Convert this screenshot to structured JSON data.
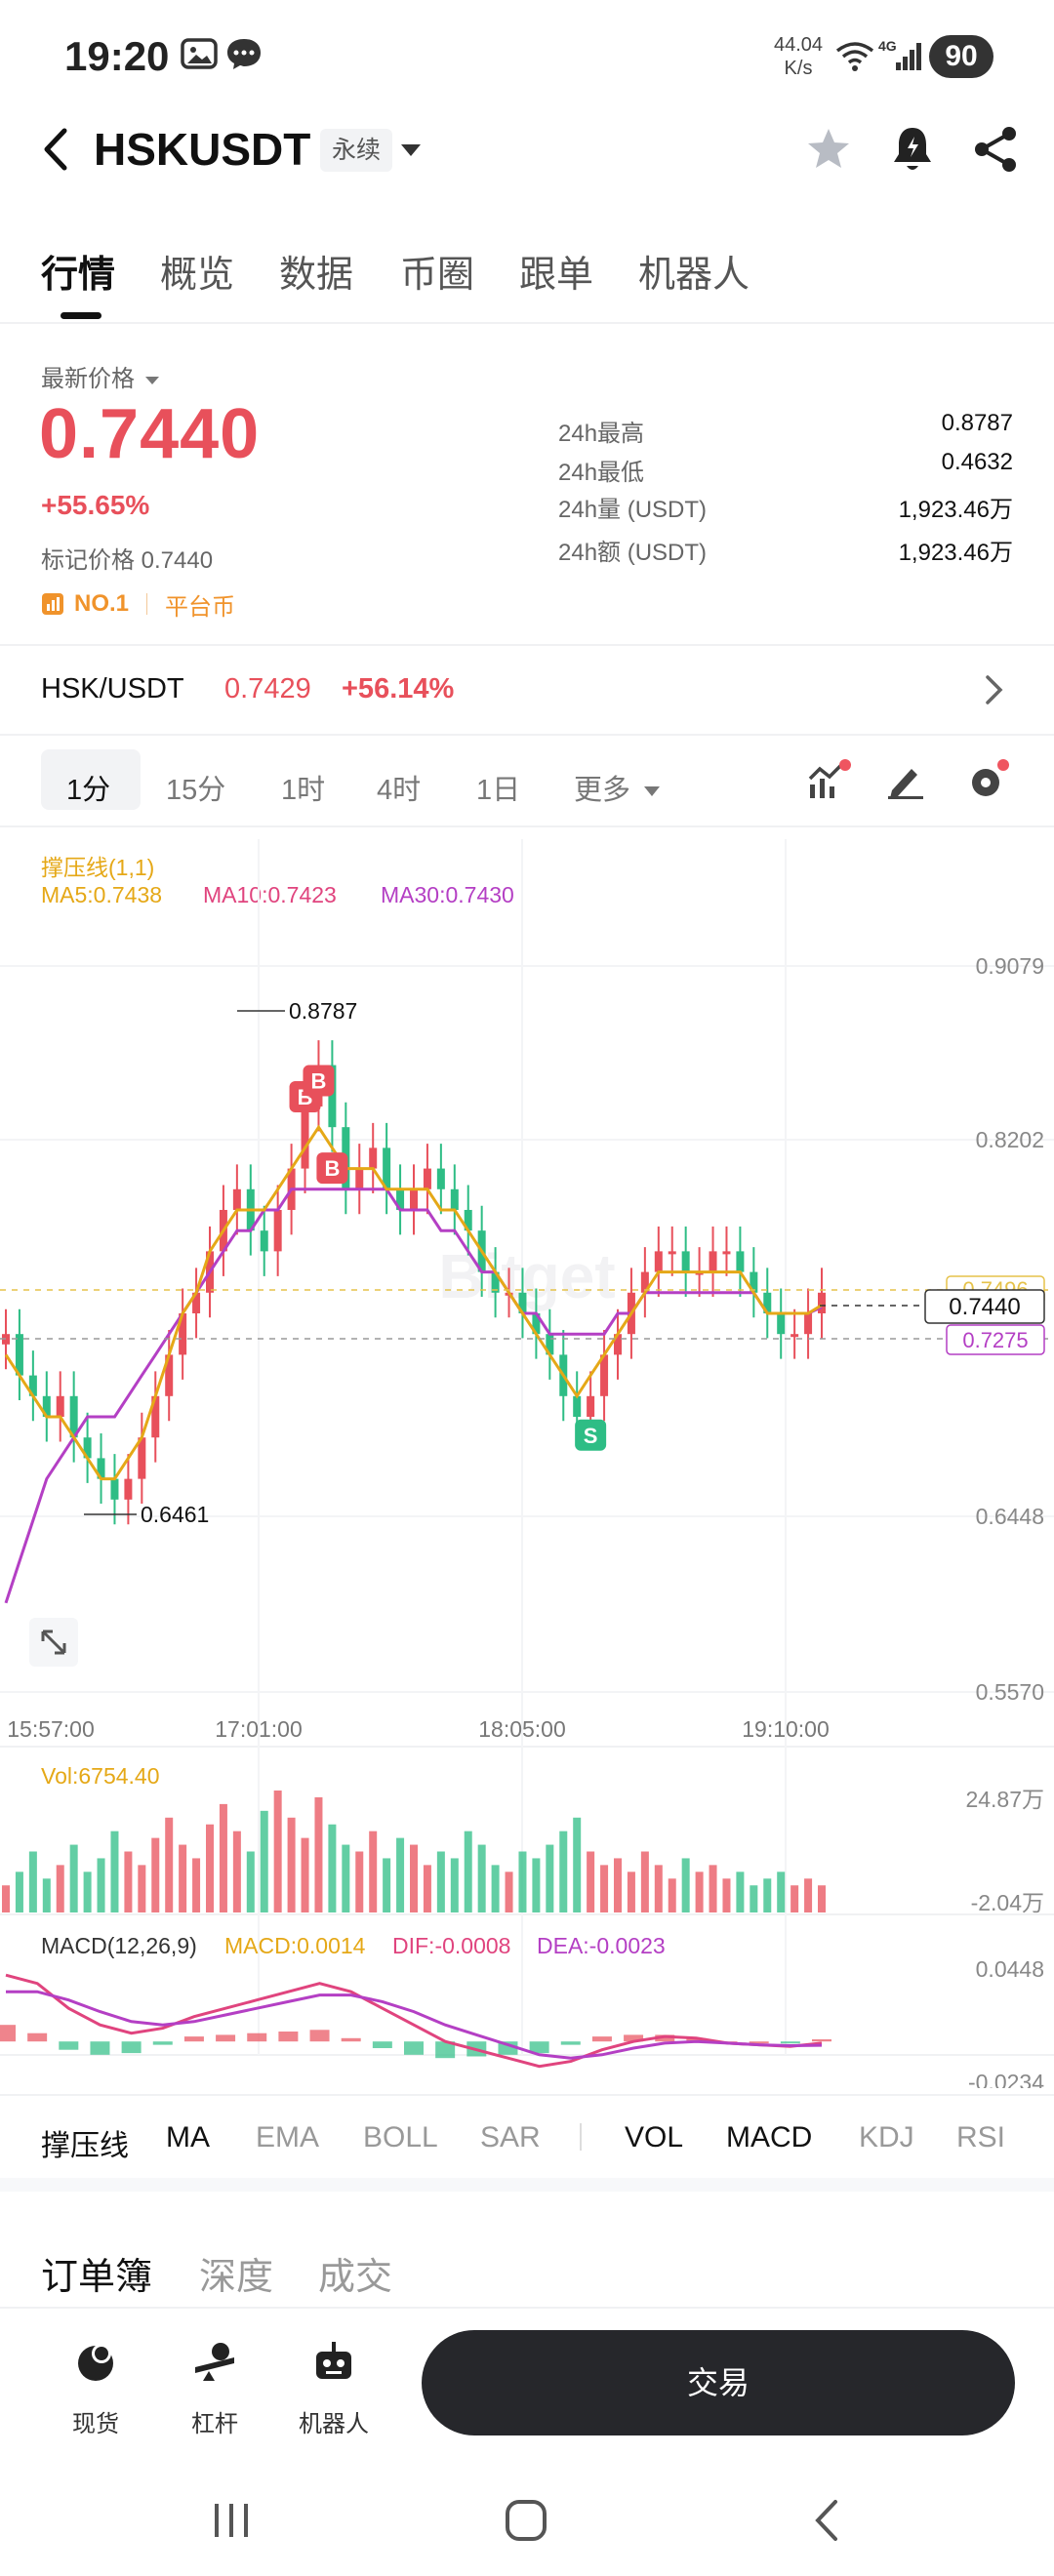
{
  "status_bar": {
    "time": "19:20",
    "net_speed_value": "44.04",
    "net_speed_unit": "K/s",
    "battery": "90"
  },
  "header": {
    "pair": "HSKUSDT",
    "badge": "永续"
  },
  "main_tabs": [
    "行情",
    "概览",
    "数据",
    "币圈",
    "跟单",
    "机器人"
  ],
  "price_block": {
    "latest_label": "最新价格",
    "last_price": "0.7440",
    "change": "+55.65%",
    "mark_price": "标记价格 0.7440",
    "rank": "NO.1",
    "category": "平台币",
    "stats": [
      {
        "label": "24h最高",
        "value": "0.8787"
      },
      {
        "label": "24h最低",
        "value": "0.4632"
      },
      {
        "label": "24h量 (USDT)",
        "value": "1,923.46万"
      },
      {
        "label": "24h额 (USDT)",
        "value": "1,923.46万"
      }
    ]
  },
  "spot_row": {
    "pair": "HSK/USDT",
    "price": "0.7429",
    "change": "+56.14%"
  },
  "interval_tabs": [
    "1分",
    "15分",
    "1时",
    "4时",
    "1日",
    "更多"
  ],
  "chart_data": {
    "type": "candlestick",
    "legend": {
      "support_line": "撑压线(1,1)",
      "ma5": "MA5:0.7438",
      "ma10": "MA10:0.7423",
      "ma30": "MA30:0.7430"
    },
    "y_axis_labels": [
      "0.9079",
      "0.8202",
      "0.6448",
      "0.5570"
    ],
    "ylim": [
      0.557,
      0.9079
    ],
    "x_axis_labels": [
      "15:57:00",
      "17:01:00",
      "18:05:00",
      "19:10:00"
    ],
    "high_marker": "0.8787",
    "low_marker": "0.6461",
    "price_tag_current": "0.7440",
    "price_tag_upper": "0.7496",
    "price_tag_lower": "0.7275",
    "close_series": [
      0.73,
      0.71,
      0.7,
      0.69,
      0.7,
      0.68,
      0.67,
      0.66,
      0.65,
      0.66,
      0.68,
      0.7,
      0.72,
      0.74,
      0.75,
      0.77,
      0.79,
      0.8,
      0.78,
      0.77,
      0.79,
      0.81,
      0.84,
      0.86,
      0.83,
      0.8,
      0.81,
      0.82,
      0.8,
      0.79,
      0.8,
      0.81,
      0.8,
      0.79,
      0.78,
      0.76,
      0.75,
      0.75,
      0.74,
      0.73,
      0.72,
      0.7,
      0.69,
      0.7,
      0.72,
      0.73,
      0.75,
      0.76,
      0.77,
      0.77,
      0.76,
      0.76,
      0.77,
      0.77,
      0.76,
      0.75,
      0.74,
      0.73,
      0.73,
      0.74,
      0.75
    ],
    "ma5_series": [
      0.72,
      0.71,
      0.7,
      0.69,
      0.69,
      0.68,
      0.67,
      0.66,
      0.66,
      0.67,
      0.68,
      0.7,
      0.72,
      0.74,
      0.75,
      0.77,
      0.78,
      0.79,
      0.79,
      0.79,
      0.8,
      0.81,
      0.82,
      0.83,
      0.82,
      0.81,
      0.81,
      0.81,
      0.8,
      0.8,
      0.8,
      0.8,
      0.79,
      0.79,
      0.78,
      0.77,
      0.76,
      0.75,
      0.74,
      0.73,
      0.72,
      0.71,
      0.7,
      0.71,
      0.72,
      0.73,
      0.74,
      0.75,
      0.76,
      0.76,
      0.76,
      0.76,
      0.76,
      0.76,
      0.76,
      0.75,
      0.74,
      0.74,
      0.74,
      0.74,
      0.744
    ],
    "ma30_series": [
      0.6,
      0.62,
      0.64,
      0.66,
      0.67,
      0.68,
      0.69,
      0.69,
      0.69,
      0.7,
      0.71,
      0.72,
      0.73,
      0.74,
      0.75,
      0.76,
      0.77,
      0.78,
      0.78,
      0.79,
      0.79,
      0.8,
      0.8,
      0.8,
      0.8,
      0.8,
      0.8,
      0.8,
      0.8,
      0.79,
      0.79,
      0.79,
      0.78,
      0.78,
      0.77,
      0.76,
      0.76,
      0.75,
      0.74,
      0.74,
      0.73,
      0.73,
      0.73,
      0.73,
      0.73,
      0.74,
      0.74,
      0.75,
      0.75,
      0.75,
      0.75,
      0.75,
      0.75,
      0.75,
      0.75,
      0.75,
      0.74,
      0.74,
      0.74,
      0.74,
      0.743
    ],
    "trade_markers": [
      {
        "label": "B",
        "index": 22
      },
      {
        "label": "B",
        "index": 23
      },
      {
        "label": "B",
        "index": 24
      },
      {
        "label": "S",
        "index": 43
      }
    ],
    "volume": {
      "label": "Vol:6754.40",
      "axis_top": "24.87万",
      "axis_bottom": "-2.04万",
      "values": [
        4,
        6,
        9,
        5,
        7,
        10,
        6,
        8,
        12,
        9,
        7,
        11,
        14,
        10,
        8,
        13,
        16,
        12,
        9,
        15,
        18,
        14,
        11,
        17,
        13,
        10,
        9,
        12,
        8,
        11,
        10,
        7,
        9,
        8,
        12,
        10,
        7,
        6,
        9,
        8,
        10,
        12,
        14,
        9,
        7,
        8,
        6,
        9,
        7,
        5,
        8,
        6,
        7,
        5,
        6,
        4,
        5,
        6,
        4,
        5,
        4
      ]
    },
    "macd": {
      "label": "MACD(12,26,9)",
      "macd": "MACD:0.0014",
      "dif": "DIF:-0.0008",
      "dea": "DEA:-0.0023",
      "axis_top": "0.0448",
      "axis_bottom": "-0.0234",
      "dif_series": [
        0.04,
        0.035,
        0.02,
        0.01,
        0.005,
        0.008,
        0.015,
        0.02,
        0.025,
        0.03,
        0.035,
        0.03,
        0.02,
        0.01,
        0.0,
        -0.005,
        -0.01,
        -0.015,
        -0.012,
        -0.005,
        0.0,
        0.003,
        0.002,
        -0.001,
        -0.002,
        -0.003,
        -0.001
      ],
      "dea_series": [
        0.03,
        0.03,
        0.025,
        0.018,
        0.012,
        0.01,
        0.012,
        0.016,
        0.02,
        0.024,
        0.028,
        0.028,
        0.024,
        0.018,
        0.01,
        0.004,
        -0.002,
        -0.008,
        -0.01,
        -0.008,
        -0.004,
        -0.001,
        0.0,
        -0.001,
        -0.002,
        -0.0025,
        -0.0023
      ]
    }
  },
  "indicator_tabs": {
    "main": [
      "撑压线",
      "MA",
      "EMA",
      "BOLL",
      "SAR"
    ],
    "sub": [
      "VOL",
      "MACD",
      "KDJ",
      "RSI"
    ]
  },
  "orderbook_tabs": [
    "订单簿",
    "深度",
    "成交"
  ],
  "bottom_bar": {
    "items": [
      "现货",
      "杠杆",
      "机器人"
    ],
    "trade": "交易"
  },
  "colors": {
    "up": "#e8505b",
    "down": "#2ebd85",
    "ma5": "#e5a817",
    "ma10": "#e0447e",
    "ma30": "#b43fc4",
    "accent_orange": "#f0932b"
  }
}
